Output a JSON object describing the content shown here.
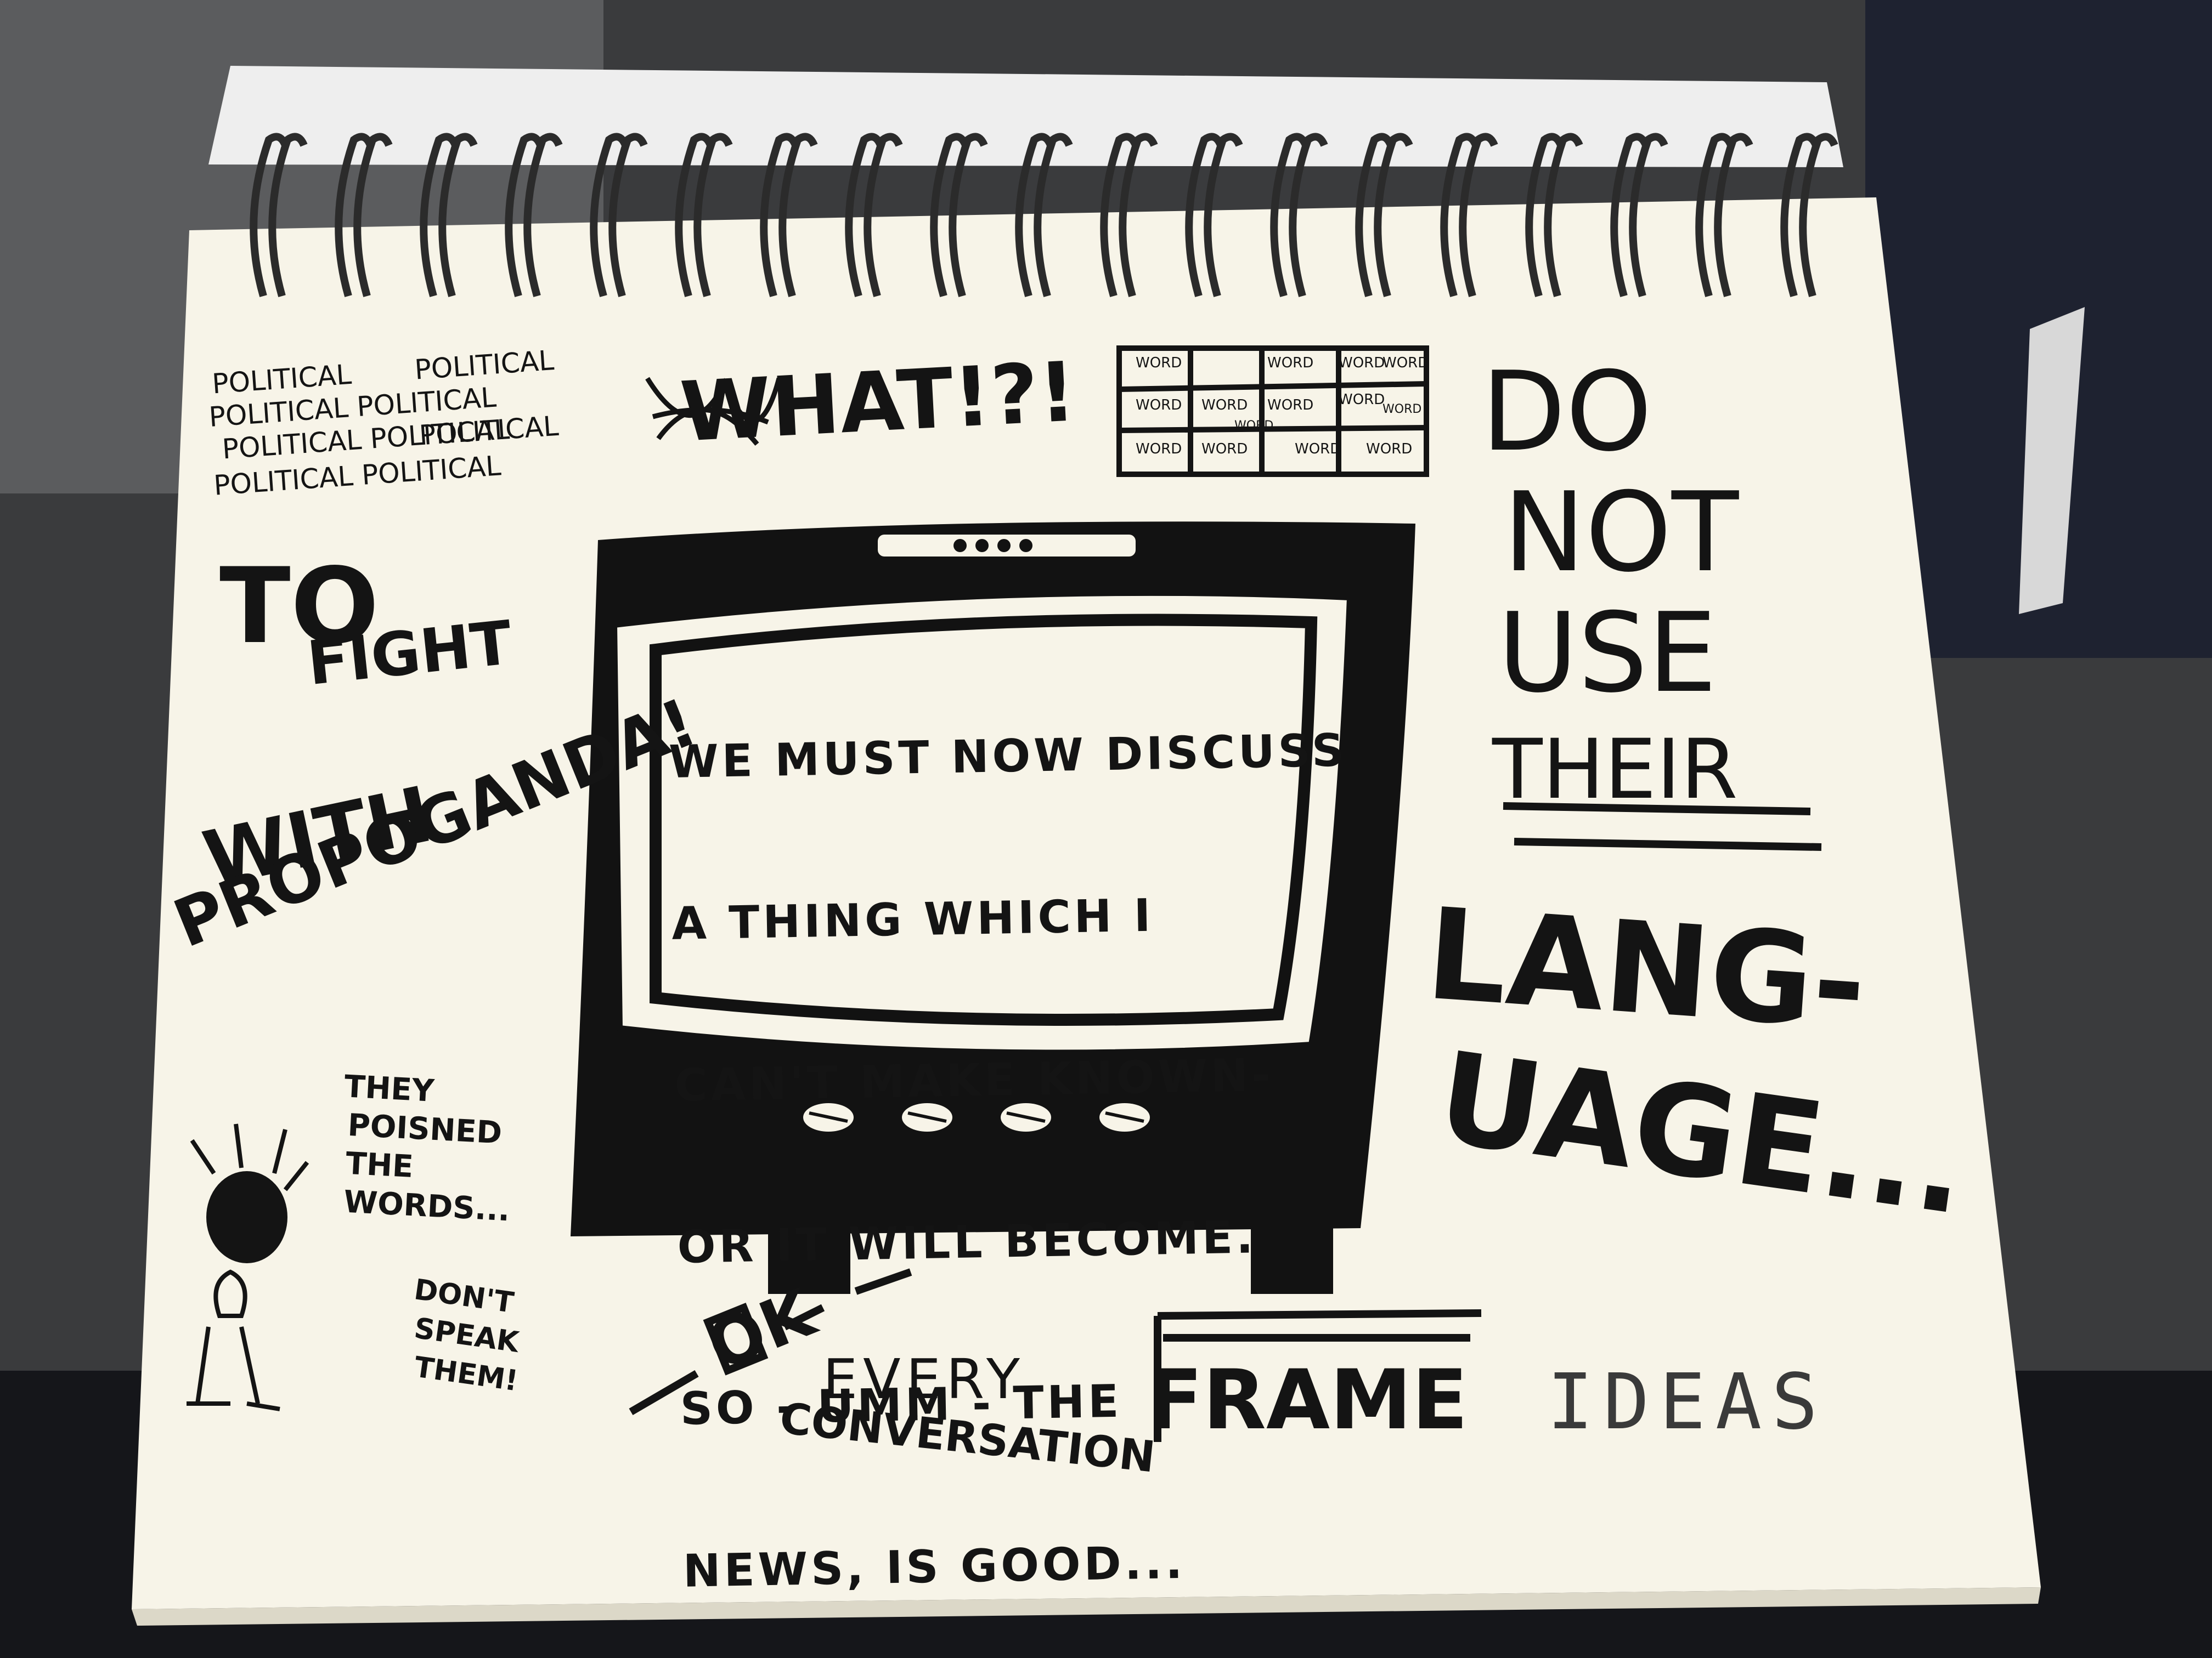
{
  "colors": {
    "paper": "#f7f4e8",
    "ink": "#141414",
    "backdrop": "#2a2a2c",
    "ring": "#2b2b2b"
  },
  "sketch": {
    "political_scribble": [
      "POLITICAL",
      "POLITICAL",
      "POLITICAL POLITICAL",
      "POLITICAL POLITICAL",
      "POLITICAL",
      "POLITICAL POLITICAL"
    ],
    "what": "WHAT!?!",
    "word_grid": [
      "WORD",
      "WORD",
      "WORD",
      "WORD",
      "WORD",
      "WORD",
      "WORD",
      "WORD",
      "WORD",
      "WORD",
      "WORD",
      "WORD",
      "WORD",
      "WORD"
    ],
    "to": "TO",
    "fight": "FIGHT",
    "with": "WITH",
    "propaganda": "PROPOGANDA!",
    "tv_screen_lines": [
      "WE MUST NOW DISCUSS",
      "A THING WHICH I",
      "CAN'T MAKE KNOWN-",
      "OR IT WILL BECOME.",
      "SO - UMM - THE",
      "NEWS, IS GOOD..."
    ],
    "do": "DO",
    "not": "NOT",
    "use": "USE",
    "their": "THEIR",
    "language_1": "LANG-",
    "language_2": "UAGE...",
    "poisoned": [
      "THEY",
      "POISNED",
      "THE",
      "WORDS..."
    ],
    "dont_speak": [
      "DON'T",
      "SPEAK",
      "THEM!"
    ],
    "ok": "OK",
    "every": "EVERY",
    "conversation": "CONVERSATION",
    "frame": "FRAME",
    "ideas": "IDEAS"
  }
}
